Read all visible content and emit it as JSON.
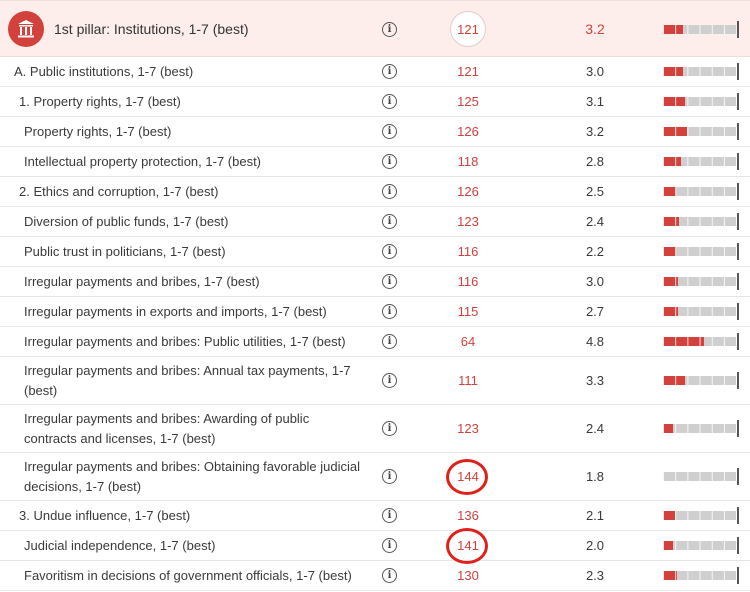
{
  "header": {
    "label": "1st pillar: Institutions, 1-7 (best)",
    "rank": "121",
    "score": "3.2",
    "bar_fraction": 0.27
  },
  "rows": [
    {
      "label": "A. Public institutions, 1-7 (best)",
      "rank": "121",
      "score": "3.0",
      "bar_fraction": 0.27
    },
    {
      "label": "1. Property rights, 1-7 (best)",
      "rank": "125",
      "score": "3.1",
      "bar_fraction": 0.3
    },
    {
      "label": "Property rights, 1-7 (best)",
      "rank": "126",
      "score": "3.2",
      "bar_fraction": 0.33
    },
    {
      "label": "Intellectual property protection, 1-7 (best)",
      "rank": "118",
      "score": "2.8",
      "bar_fraction": 0.25
    },
    {
      "label": "2. Ethics and corruption, 1-7 (best)",
      "rank": "126",
      "score": "2.5",
      "bar_fraction": 0.18
    },
    {
      "label": "Diversion of public funds, 1-7 (best)",
      "rank": "123",
      "score": "2.4",
      "bar_fraction": 0.22
    },
    {
      "label": "Public trust in politicians, 1-7 (best)",
      "rank": "116",
      "score": "2.2",
      "bar_fraction": 0.18
    },
    {
      "label": "Irregular payments and bribes, 1-7 (best)",
      "rank": "116",
      "score": "3.0",
      "bar_fraction": 0.2
    },
    {
      "label": "Irregular payments in exports and imports, 1-7 (best)",
      "rank": "115",
      "score": "2.7",
      "bar_fraction": 0.2
    },
    {
      "label": "Irregular payments and bribes: Public utilities, 1-7 (best)",
      "rank": "64",
      "score": "4.8",
      "bar_fraction": 0.56
    },
    {
      "label": "Irregular payments and bribes: Annual tax payments, 1-7 (best)",
      "rank": "111",
      "score": "3.3",
      "bar_fraction": 0.3
    },
    {
      "label": "Irregular payments and bribes: Awarding of public contracts and licenses, 1-7 (best)",
      "rank": "123",
      "score": "2.4",
      "bar_fraction": 0.14
    },
    {
      "label": "Irregular payments and bribes: Obtaining favorable judicial decisions, 1-7 (best)",
      "rank": "144",
      "score": "1.8",
      "bar_fraction": 0.0
    },
    {
      "label": "3. Undue influence, 1-7 (best)",
      "rank": "136",
      "score": "2.1",
      "bar_fraction": 0.16
    },
    {
      "label": "Judicial independence, 1-7 (best)",
      "rank": "141",
      "score": "2.0",
      "bar_fraction": 0.14
    },
    {
      "label": "Favoritism in decisions of government officials, 1-7 (best)",
      "rank": "130",
      "score": "2.3",
      "bar_fraction": 0.19
    }
  ],
  "info_glyph": "i",
  "icons": {
    "pillar": "institution-building-icon",
    "info": "info-icon"
  },
  "colors": {
    "accent": "#d2413b",
    "header_bg": "#fdeeeb",
    "bar_bg": "#cfcfcf",
    "highlight": "#e0201a"
  }
}
